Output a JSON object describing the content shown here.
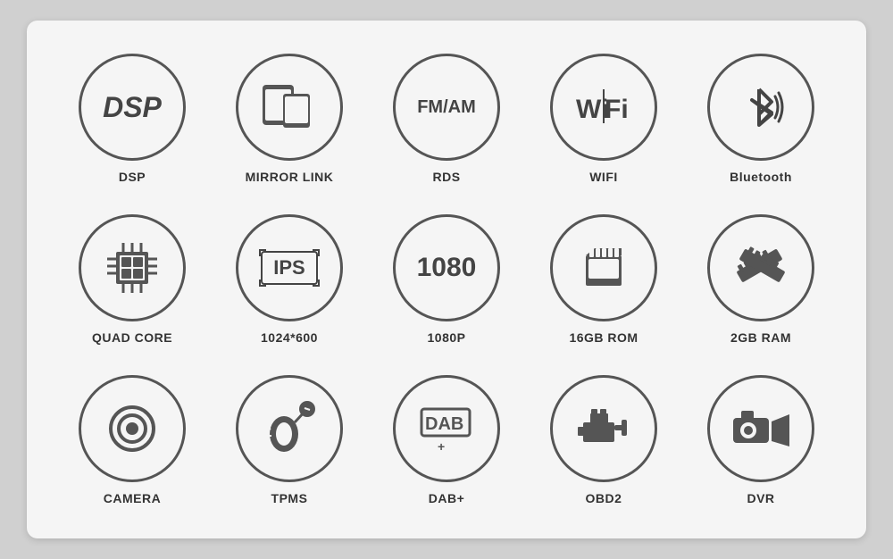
{
  "features": {
    "row1": [
      {
        "id": "dsp",
        "label": "DSP",
        "icon": "dsp"
      },
      {
        "id": "mirror-link",
        "label": "MIRROR LINK",
        "icon": "mirror-link"
      },
      {
        "id": "rds",
        "label": "RDS",
        "icon": "rds"
      },
      {
        "id": "wifi",
        "label": "WIFI",
        "icon": "wifi"
      },
      {
        "id": "bluetooth",
        "label": "Bluetooth",
        "icon": "bluetooth"
      }
    ],
    "row2": [
      {
        "id": "quad-core",
        "label": "QUAD CORE",
        "icon": "quad-core"
      },
      {
        "id": "ips",
        "label": "1024*600",
        "icon": "ips"
      },
      {
        "id": "1080p",
        "label": "1080P",
        "icon": "1080p"
      },
      {
        "id": "16gb-rom",
        "label": "16GB ROM",
        "icon": "16gb-rom"
      },
      {
        "id": "2gb-ram",
        "label": "2GB RAM",
        "icon": "2gb-ram"
      }
    ],
    "row3": [
      {
        "id": "camera",
        "label": "CAMERA",
        "icon": "camera"
      },
      {
        "id": "tpms",
        "label": "TPMS",
        "icon": "tpms"
      },
      {
        "id": "dab",
        "label": "DAB+",
        "icon": "dab"
      },
      {
        "id": "obd2",
        "label": "OBD2",
        "icon": "obd2"
      },
      {
        "id": "dvr",
        "label": "DVR",
        "icon": "dvr"
      }
    ]
  }
}
